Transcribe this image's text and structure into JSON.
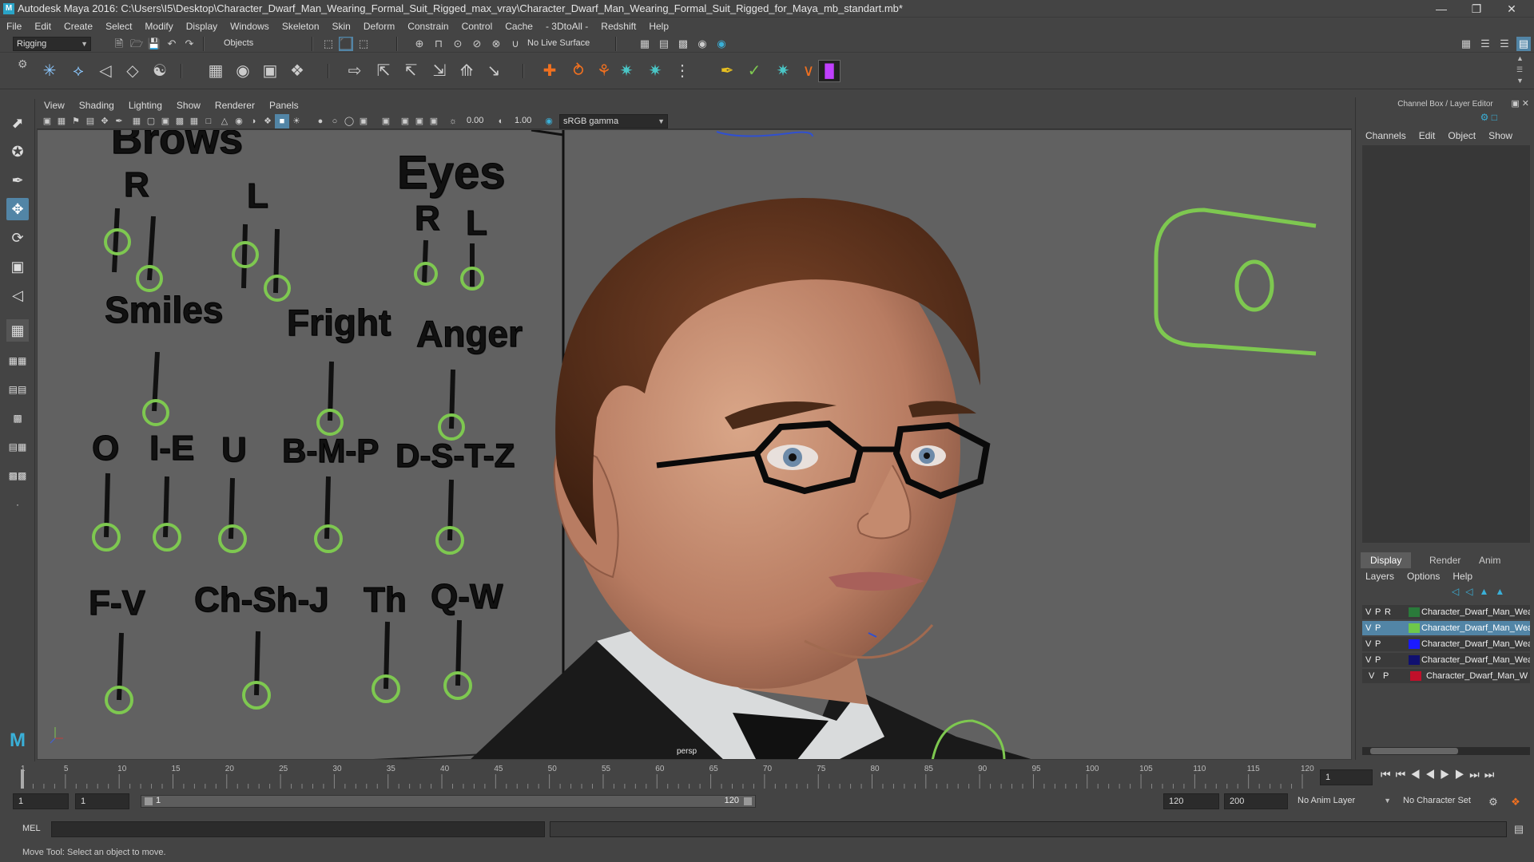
{
  "window": {
    "title": "Autodesk Maya 2016: C:\\Users\\I5\\Desktop\\Character_Dwarf_Man_Wearing_Formal_Suit_Rigged_max_vray\\Character_Dwarf_Man_Wearing_Formal_Suit_Rigged_for_Maya_mb_standart.mb*",
    "icon": "M"
  },
  "menubar": [
    "File",
    "Edit",
    "Create",
    "Select",
    "Modify",
    "Display",
    "Windows",
    "Skeleton",
    "Skin",
    "Deform",
    "Constrain",
    "Control",
    "Cache",
    "- 3DtoAll -",
    "Redshift",
    "Help"
  ],
  "statusline": {
    "mode": "Rigging",
    "selection_mode": "Objects",
    "live_surface": "No Live Surface"
  },
  "panel_menu": [
    "View",
    "Shading",
    "Lighting",
    "Show",
    "Renderer",
    "Panels"
  ],
  "panel_toolbar": {
    "exposure": "0.00",
    "gamma": "1.00",
    "color_space": "sRGB gamma"
  },
  "viewport": {
    "camera_label": "persp",
    "facial_labels": {
      "brows": "Brows",
      "brows_r": "R",
      "brows_l": "L",
      "eyes": "Eyes",
      "eyes_r": "R",
      "eyes_l": "L",
      "smiles": "Smiles",
      "fright": "Fright",
      "anger": "Anger",
      "o": "O",
      "ie": "I-E",
      "u": "U",
      "bmp": "B-M-P",
      "dstz": "D-S-T-Z",
      "fv": "F-V",
      "chshj": "Ch-Sh-J",
      "th": "Th",
      "qw": "Q-W"
    },
    "colors": {
      "controller": "#7ec850",
      "skin": "#c98f72",
      "hair": "#5a2f1a",
      "background": "#616161"
    }
  },
  "channel_box": {
    "header": "Channel Box / Layer Editor",
    "menu": [
      "Channels",
      "Edit",
      "Object",
      "Show"
    ]
  },
  "layer_editor": {
    "tabs": [
      "Display",
      "Render",
      "Anim"
    ],
    "active_tab": "Display",
    "menu": [
      "Layers",
      "Options",
      "Help"
    ],
    "layers": [
      {
        "v": "V",
        "p": "P",
        "r": "R",
        "color": "#2a7a3a",
        "name": "Character_Dwarf_Man_Weari"
      },
      {
        "v": "V",
        "p": "P",
        "r": "",
        "color": "#6ec84a",
        "name": "Character_Dwarf_Man_Weari"
      },
      {
        "v": "V",
        "p": "P",
        "r": "",
        "color": "#1a1aff",
        "name": "Character_Dwarf_Man_Weari"
      },
      {
        "v": "V",
        "p": "P",
        "r": "",
        "color": "#101070",
        "name": "Character_Dwarf_Man_Weari"
      },
      {
        "v": "V",
        "p": "P",
        "r": "",
        "color": "#c0102a",
        "name": "Character_Dwarf_Man_W"
      }
    ]
  },
  "timeline": {
    "ticks": [
      "1",
      "5",
      "10",
      "15",
      "20",
      "25",
      "30",
      "35",
      "40",
      "45",
      "50",
      "55",
      "60",
      "65",
      "70",
      "75",
      "80",
      "85",
      "90",
      "95",
      "100",
      "105",
      "110",
      "115",
      "120"
    ],
    "current_frame": "1"
  },
  "range": {
    "start": "1",
    "playback_start": "1",
    "slider_start": "1",
    "slider_end": "120",
    "playback_end": "120",
    "end": "200",
    "anim_layer": "No Anim Layer",
    "character_set": "No Character Set"
  },
  "command_line": {
    "label": "MEL"
  },
  "help_line": "Move Tool: Select an object to move."
}
